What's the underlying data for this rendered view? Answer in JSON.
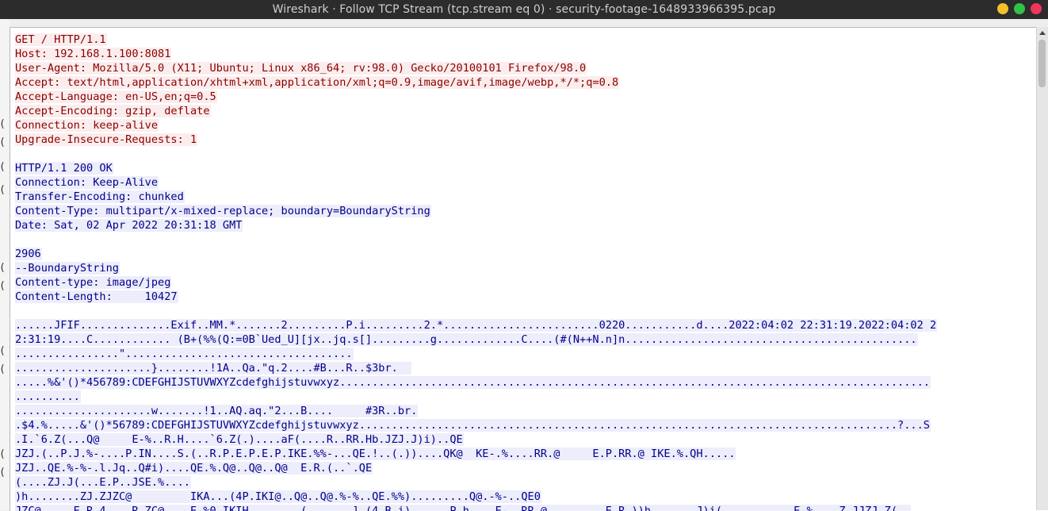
{
  "window": {
    "title": "Wireshark · Follow TCP Stream (tcp.stream eq 0) · security-footage-1648933966395.pcap"
  },
  "left_strip": [
    "(",
    "(",
    "(",
    "(",
    "(",
    "(",
    "(",
    "(",
    "(",
    "("
  ],
  "stream": {
    "client_lines": [
      "GET / HTTP/1.1",
      "Host: 192.168.1.100:8081",
      "User-Agent: Mozilla/5.0 (X11; Ubuntu; Linux x86_64; rv:98.0) Gecko/20100101 Firefox/98.0",
      "Accept: text/html,application/xhtml+xml,application/xml;q=0.9,image/avif,image/webp,*/*;q=0.8",
      "Accept-Language: en-US,en;q=0.5",
      "Accept-Encoding: gzip, deflate",
      "Connection: keep-alive",
      "Upgrade-Insecure-Requests: 1"
    ],
    "server_headers": [
      "HTTP/1.1 200 OK",
      "Connection: Keep-Alive",
      "Transfer-Encoding: chunked",
      "Content-Type: multipart/x-mixed-replace; boundary=BoundaryString",
      "Date: Sat, 02 Apr 2022 20:31:18 GMT"
    ],
    "server_chunk": [
      "2906",
      "--BoundaryString",
      "Content-type: image/jpeg",
      "Content-Length:     10427"
    ],
    "server_binary": [
      "......JFIF..............Exif..MM.*.......2.........P.i.........2.*........................0220...........d....2022:04:02 22:31:19.2022:04:02 2",
      "2:31:19....C............ (B+(%%(Q:=0B`Ued_U][jx..jq.s[].........g.............C....(#(N++N.n]n.............................................",
      "................\"...................................",
      ".....................}........!1A..Qa.\"q.2....#B...R..$3br.  ",
      ".....%&'()*456789:CDEFGHIJSTUVWXYZcdefghijstuvwxyz...........................................................................................",
      "..........",
      ".....................w.......!1..AQ.aq.\"2...B....     #3R..br.",
      ".$4.%.....&'()*56789:CDEFGHIJSTUVWXYZcdefghijstuvwxyz...................................................................................?...S",
      ".I.`6.Z(...Q@     E-%..R.H....`6.Z(.)....aF(....R..RR.Hb.JZJ.J)i)..QE",
      "JZJ.(..P.J.%-....P.IN....S.(..R.P.E.P.E.P.IKE.%%-...QE.!..(.))....QK@  KE-.%....RR.@     E.P.RR.@ IKE.%.QH.....",
      "JZJ..QE.%-%-.l.Jq..Q#i)....QE.%.Q@..Q@..Q@  E.R.(..`.QE",
      "(....ZJ.J(...E.P..JSE.%....",
      ")h........ZJ.ZJZC@         IKA...(4P.IKI@..Q@..Q@.%-%..QE.%%).........Q@.-%-..QE0",
      "JZC@     E.R.4....R.ZC@    E-%0.IKIH........(.......].(4.B.i)......P.h....E-..RR.@         E.R.))h.......J)i(...........E-%....Z.JJZJ.Z(.."
    ]
  }
}
